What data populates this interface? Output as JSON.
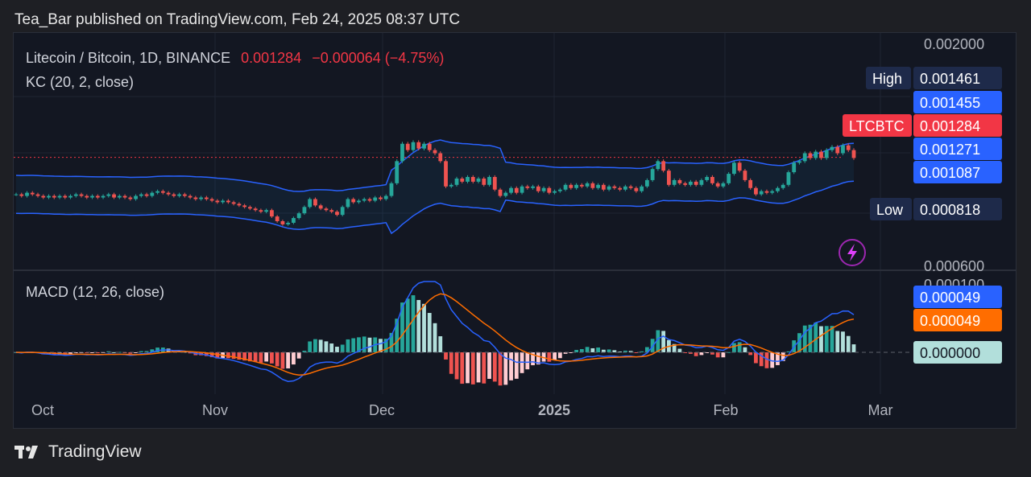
{
  "header": {
    "published": "Tea_Bar published on TradingView.com, Feb 24, 2025 08:37 UTC"
  },
  "legend": {
    "symbol": "Litecoin / Bitcoin, 1D, BINANCE",
    "price": "0.001284",
    "change": "−0.000064 (−4.75%)",
    "indicator": "KC (20, 2, close)",
    "macd": "MACD (12, 26, close)"
  },
  "labels": {
    "high_tag": "High",
    "low_tag": "Low",
    "ticker_tag": "LTCBTC",
    "high": "0.001461",
    "kc_upper": "0.001455",
    "last": "0.001284",
    "kc_mid": "0.001271",
    "kc_lower": "0.001087",
    "low": "0.000818",
    "macd_line": "0.000049",
    "signal_line": "0.000049",
    "zero": "0.000000",
    "macd_top_tick": "0.000100"
  },
  "footer": {
    "brand": "TradingView"
  },
  "colors": {
    "up": "#26a69a",
    "down": "#ef5350",
    "kc_band": "#2962ff",
    "macd": "#2962ff",
    "signal": "#ff6d00",
    "accent_red": "#f23645",
    "tag_bg": "#1e2a4a",
    "blue_tag": "#2962ff"
  },
  "chart_data": [
    {
      "type": "candlestick",
      "title": "Litecoin / Bitcoin, 1D, BINANCE",
      "overlay": "KC (20, 2, close)",
      "y_axis": {
        "ticks": [
          "0.002000",
          "0.000600"
        ],
        "ylim": [
          0.0006,
          0.002
        ]
      },
      "x_axis": {
        "ticks": [
          "Oct",
          "Nov",
          "Dec",
          "2025",
          "Feb",
          "Mar"
        ]
      },
      "close_approx": [
        0.00105,
        0.00104,
        0.00106,
        0.00105,
        0.00104,
        0.00103,
        0.00104,
        0.00103,
        0.00104,
        0.00103,
        0.00104,
        0.00105,
        0.00104,
        0.00103,
        0.00104,
        0.00103,
        0.00104,
        0.00105,
        0.00103,
        0.00104,
        0.00103,
        0.00102,
        0.00104,
        0.00105,
        0.00104,
        0.00106,
        0.00107,
        0.00106,
        0.00105,
        0.00104,
        0.00105,
        0.00104,
        0.00103,
        0.00102,
        0.00103,
        0.00102,
        0.00101,
        0.001,
        0.00101,
        0.001,
        0.00099,
        0.00098,
        0.00097,
        0.00096,
        0.00095,
        0.00094,
        0.00095,
        0.00091,
        0.00088,
        0.00086,
        0.00087,
        0.0009,
        0.00093,
        0.00097,
        0.00102,
        0.00098,
        0.00096,
        0.00095,
        0.00094,
        0.00092,
        0.00097,
        0.00102,
        0.001,
        0.00101,
        0.00102,
        0.00101,
        0.00103,
        0.00102,
        0.00104,
        0.00112,
        0.00126,
        0.00137,
        0.00133,
        0.00138,
        0.00134,
        0.00137,
        0.00133,
        0.00131,
        0.00126,
        0.0011,
        0.00111,
        0.00115,
        0.00113,
        0.00116,
        0.00113,
        0.00115,
        0.00111,
        0.00116,
        0.00108,
        0.00104,
        0.00106,
        0.00109,
        0.00106,
        0.0011,
        0.00109,
        0.0011,
        0.00107,
        0.00109,
        0.00106,
        0.00107,
        0.00108,
        0.00111,
        0.00109,
        0.00111,
        0.0011,
        0.00112,
        0.00109,
        0.00111,
        0.00108,
        0.0011,
        0.00109,
        0.00108,
        0.0011,
        0.00109,
        0.00107,
        0.0011,
        0.00114,
        0.00121,
        0.00126,
        0.0012,
        0.00111,
        0.00114,
        0.00112,
        0.00111,
        0.00113,
        0.00111,
        0.00114,
        0.00116,
        0.00112,
        0.0011,
        0.00112,
        0.00118,
        0.00125,
        0.0012,
        0.00114,
        0.00109,
        0.00105,
        0.00107,
        0.00106,
        0.00107,
        0.00109,
        0.00111,
        0.00119,
        0.00125,
        0.00126,
        0.00131,
        0.00128,
        0.00132,
        0.00128,
        0.00133,
        0.00135,
        0.00131,
        0.00136,
        0.00133,
        0.00128
      ],
      "last_price": 0.001284,
      "high": 0.001461,
      "low": 0.000818
    },
    {
      "type": "macd",
      "title": "MACD (12, 26, close)",
      "macd_value": 4.9e-05,
      "signal_value": 4.9e-05
    }
  ]
}
